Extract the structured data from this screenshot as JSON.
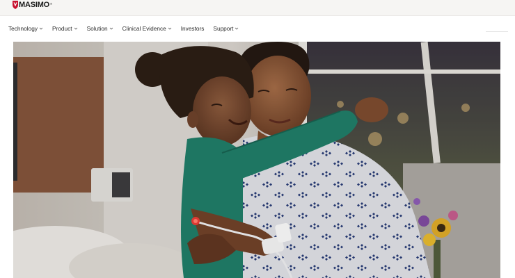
{
  "brand": {
    "name": "MASIMO",
    "trademark": "®",
    "logo_color": "#c8102e"
  },
  "nav": {
    "items": [
      {
        "label": "Technology",
        "has_dropdown": true,
        "icon": "chevron-down-icon"
      },
      {
        "label": "Product",
        "has_dropdown": true,
        "icon": "chevron-down-icon"
      },
      {
        "label": "Solution",
        "has_dropdown": true,
        "icon": "chevron-down-icon"
      },
      {
        "label": "Clinical Evidence",
        "has_dropdown": true,
        "icon": "chevron-down-icon"
      },
      {
        "label": "Investors",
        "has_dropdown": false
      },
      {
        "label": "Support",
        "has_dropdown": true,
        "icon": "chevron-down-icon"
      }
    ]
  },
  "hero": {
    "subject": "hero-image",
    "colors": {
      "background": "#c9c4bf",
      "green_shirt": "#1f7a66",
      "gown": "#e9eaf0",
      "gown_pattern": "#2a3e7a"
    }
  }
}
